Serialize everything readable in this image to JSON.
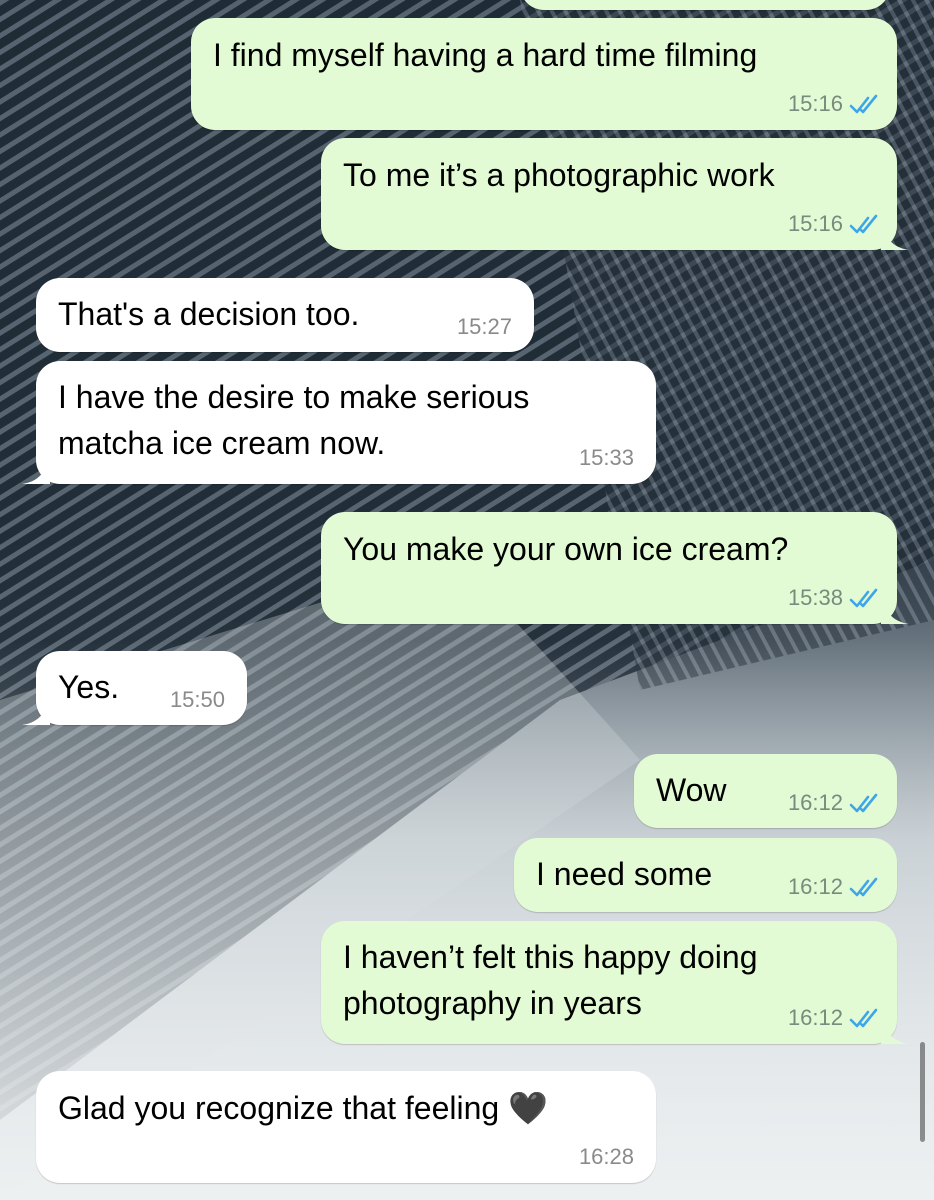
{
  "messages": [
    {
      "direction": "out",
      "text": "I find myself having a hard time filming",
      "time": "15:16",
      "status": "read"
    },
    {
      "direction": "out",
      "text": "To me it’s a photographic work",
      "time": "15:16",
      "status": "read"
    },
    {
      "direction": "in",
      "text": "That's a decision too.",
      "time": "15:27"
    },
    {
      "direction": "in",
      "text": "I have the desire to make serious\nmatcha ice cream now.",
      "time": "15:33"
    },
    {
      "direction": "out",
      "text": "You make your own ice cream?",
      "time": "15:38",
      "status": "read"
    },
    {
      "direction": "in",
      "text": "Yes.",
      "time": "15:50"
    },
    {
      "direction": "out",
      "text": "Wow",
      "time": "16:12",
      "status": "read"
    },
    {
      "direction": "out",
      "text": "I need some",
      "time": "16:12",
      "status": "read"
    },
    {
      "direction": "out",
      "text": "I haven’t felt this happy doing\nphotography in years",
      "time": "16:12",
      "status": "read"
    },
    {
      "direction": "in",
      "text": "Glad you recognize that feeling 🖤",
      "time": "16:28"
    }
  ],
  "colors": {
    "outgoing_bubble": "#e2fbd4",
    "incoming_bubble": "#ffffff",
    "read_ticks": "#3ea6e8",
    "time_text": "#7a8a7e"
  },
  "icons": {
    "read_status": "double-check-icon",
    "heart": "black-heart-emoji"
  }
}
